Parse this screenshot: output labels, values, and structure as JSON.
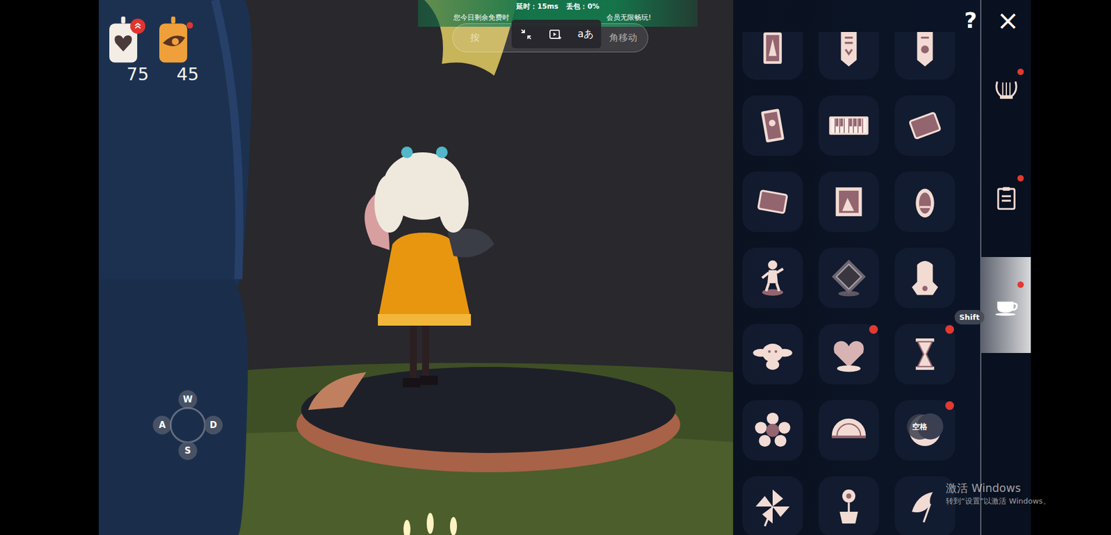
{
  "cloud_bar": {
    "latency": "延时：15ms",
    "packet_loss": "丢包：0%",
    "notice_left": "您今日剩余免费时",
    "notice_right": "会员无限畅玩!",
    "hint_left": "按",
    "hint_right": "角移动",
    "toolbar_text": "aあ"
  },
  "hud": {
    "currencies": [
      {
        "value": "75",
        "badge": "rank"
      },
      {
        "value": "45",
        "badge": "dot"
      }
    ]
  },
  "controls": {
    "keys": [
      {
        "label": "W",
        "slot": "up"
      },
      {
        "label": "A",
        "slot": "left"
      },
      {
        "label": "D",
        "slot": "right"
      },
      {
        "label": "S",
        "slot": "down"
      }
    ]
  },
  "key_hints": [
    {
      "label": "Shift",
      "kind": "pill"
    },
    {
      "label": "空格",
      "kind": "circle"
    }
  ],
  "items": [
    {
      "badge": false
    },
    {
      "badge": false
    },
    {
      "badge": false
    },
    {
      "badge": false
    },
    {
      "badge": false
    },
    {
      "badge": false
    },
    {
      "badge": false
    },
    {
      "badge": false
    },
    {
      "badge": false
    },
    {
      "badge": false
    },
    {
      "badge": false
    },
    {
      "badge": false
    },
    {
      "badge": false
    },
    {
      "badge": true
    },
    {
      "badge": true
    },
    {
      "badge": false
    },
    {
      "badge": false
    },
    {
      "badge": true
    },
    {
      "badge": false
    },
    {
      "badge": false
    },
    {
      "badge": false
    }
  ],
  "tabs": [
    {
      "selected": false,
      "badge": true
    },
    {
      "selected": false,
      "badge": true
    },
    {
      "selected": true,
      "badge": true
    }
  ],
  "header": {
    "help": "?",
    "close": "×"
  },
  "watermark": {
    "title": "激活 Windows",
    "subtitle": "转到“设置”以激活 Windows。"
  }
}
